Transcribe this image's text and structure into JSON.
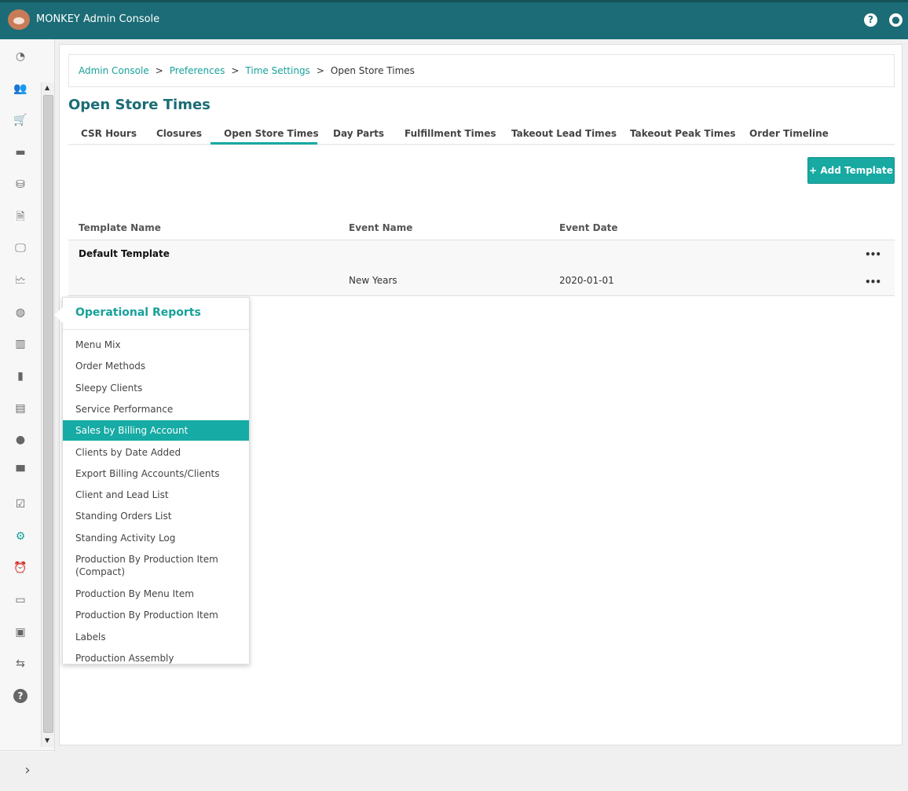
{
  "header": {
    "title": "MONKEY Admin Console",
    "help_icon": "question-circle-icon",
    "user_icon": "user-circle-icon"
  },
  "sidebar": {
    "icons": [
      "dashboard-icon",
      "users-icon",
      "cart-icon",
      "credit-card-icon",
      "coins-icon",
      "invoice-icon",
      "monitor-icon",
      "report-chart-icon",
      "report-pie-icon",
      "report-bar-icon",
      "analytics-icon",
      "catalog-icon",
      "person-icon",
      "store-icon",
      "checklist-icon",
      "gear-icon",
      "alarm-icon",
      "devices-icon",
      "contact-icon",
      "transfer-icon",
      "help-icon"
    ],
    "active": "gear-icon",
    "accent": "#17a19a"
  },
  "breadcrumb": {
    "items": [
      "Admin Console",
      "Preferences",
      "Time Settings"
    ],
    "current": "Open Store Times",
    "separator": ">"
  },
  "page": {
    "title": "Open Store Times"
  },
  "tabs": [
    {
      "label": "CSR Hours"
    },
    {
      "label": "Closures"
    },
    {
      "label": "Open Store Times",
      "active": true
    },
    {
      "label": "Day Parts"
    },
    {
      "label": "Fulfillment Times"
    },
    {
      "label": "Takeout Lead Times"
    },
    {
      "label": "Takeout Peak Times"
    },
    {
      "label": "Order Timeline"
    }
  ],
  "toolbar": {
    "add_label": "+ Add Template"
  },
  "table": {
    "columns": [
      "Template Name",
      "Event Name",
      "Event Date"
    ],
    "rows": [
      {
        "template": "Default Template",
        "event": "",
        "date": "",
        "menu": "•••"
      },
      {
        "template": "",
        "event": "New Years",
        "date": "2020-01-01",
        "menu": "•••"
      }
    ]
  },
  "popup": {
    "title": "Operational Reports",
    "items": [
      "Menu Mix",
      "Order Methods",
      "Sleepy Clients",
      "Service Performance",
      "Sales by Billing Account",
      "Clients by Date Added",
      "Export Billing Accounts/Clients",
      "Client and Lead List",
      "Standing Orders List",
      "Standing Activity Log",
      "Production By Production Item (Compact)",
      "Production By Menu Item",
      "Production By Production Item",
      "Labels",
      "Production Assembly"
    ],
    "highlighted": "Sales by Billing Account"
  },
  "colors": {
    "header": "#1b6c76",
    "accent": "#17a9a2"
  }
}
